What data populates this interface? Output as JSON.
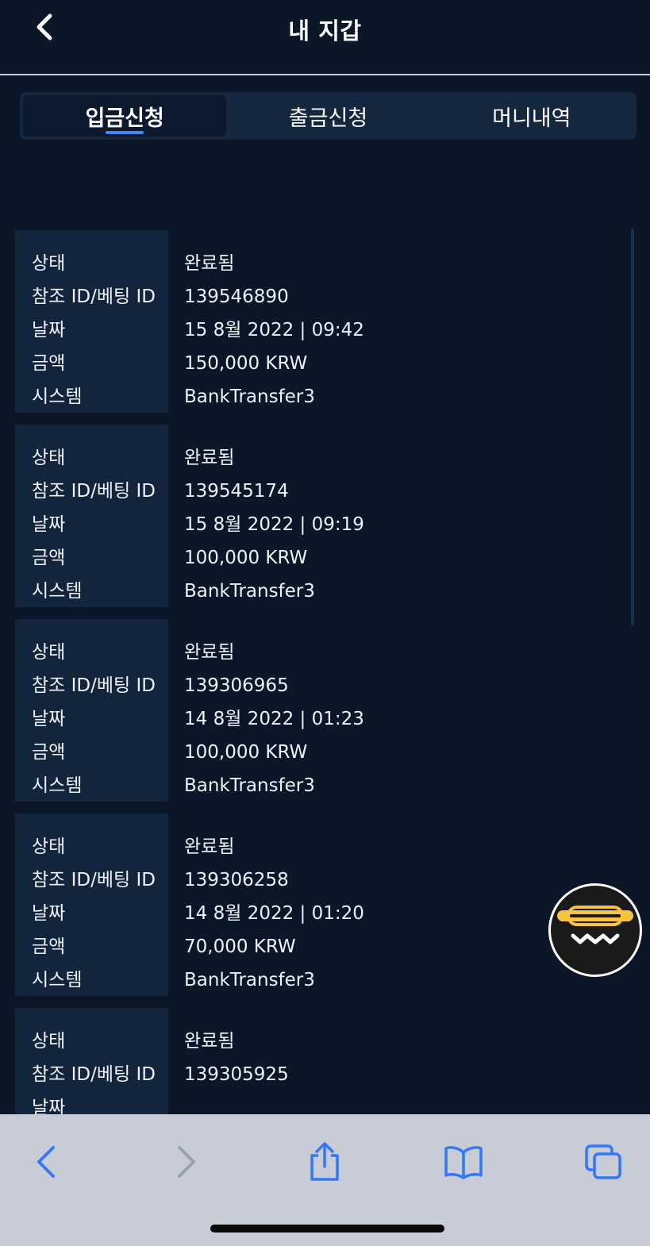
{
  "header": {
    "title": "내 지갑",
    "back_icon": "chevron-left-icon"
  },
  "tabs": [
    {
      "label": "입금신청",
      "active": true
    },
    {
      "label": "출금신청",
      "active": false
    },
    {
      "label": "머니내역",
      "active": false
    }
  ],
  "labels": {
    "status": "상태",
    "ref_id": "참조 ID/베팅 ID",
    "date": "날짜",
    "amount": "금액",
    "system": "시스템"
  },
  "transactions": [
    {
      "status": "완료됨",
      "ref_id": "139546890",
      "date": "15 8월 2022 | 09:42",
      "amount": "150,000 KRW",
      "system": "BankTransfer3"
    },
    {
      "status": "완료됨",
      "ref_id": "139545174",
      "date": "15 8월 2022 | 09:19",
      "amount": "100,000 KRW",
      "system": "BankTransfer3"
    },
    {
      "status": "완료됨",
      "ref_id": "139306965",
      "date": "14 8월 2022 | 01:23",
      "amount": "100,000 KRW",
      "system": "BankTransfer3"
    },
    {
      "status": "완료됨",
      "ref_id": "139306258",
      "date": "14 8월 2022 | 01:20",
      "amount": "70,000 KRW",
      "system": "BankTransfer3"
    },
    {
      "status": "완료됨",
      "ref_id": "139305925",
      "date": "",
      "amount": "",
      "system": ""
    }
  ],
  "colors": {
    "background": "#0b1628",
    "card_label_bg": "#13243d",
    "tab_bar_bg": "#15273f",
    "tab_indicator": "#3a8cf0",
    "fab_accent": "#f5c542",
    "toolbar_bg": "#c7ccd6",
    "toolbar_icon": "#3478f6"
  },
  "fab": {
    "icon": "chat-support-icon"
  },
  "browser_toolbar": {
    "icons": [
      "back-icon",
      "forward-icon",
      "share-icon",
      "bookmarks-icon",
      "tabs-icon"
    ]
  }
}
